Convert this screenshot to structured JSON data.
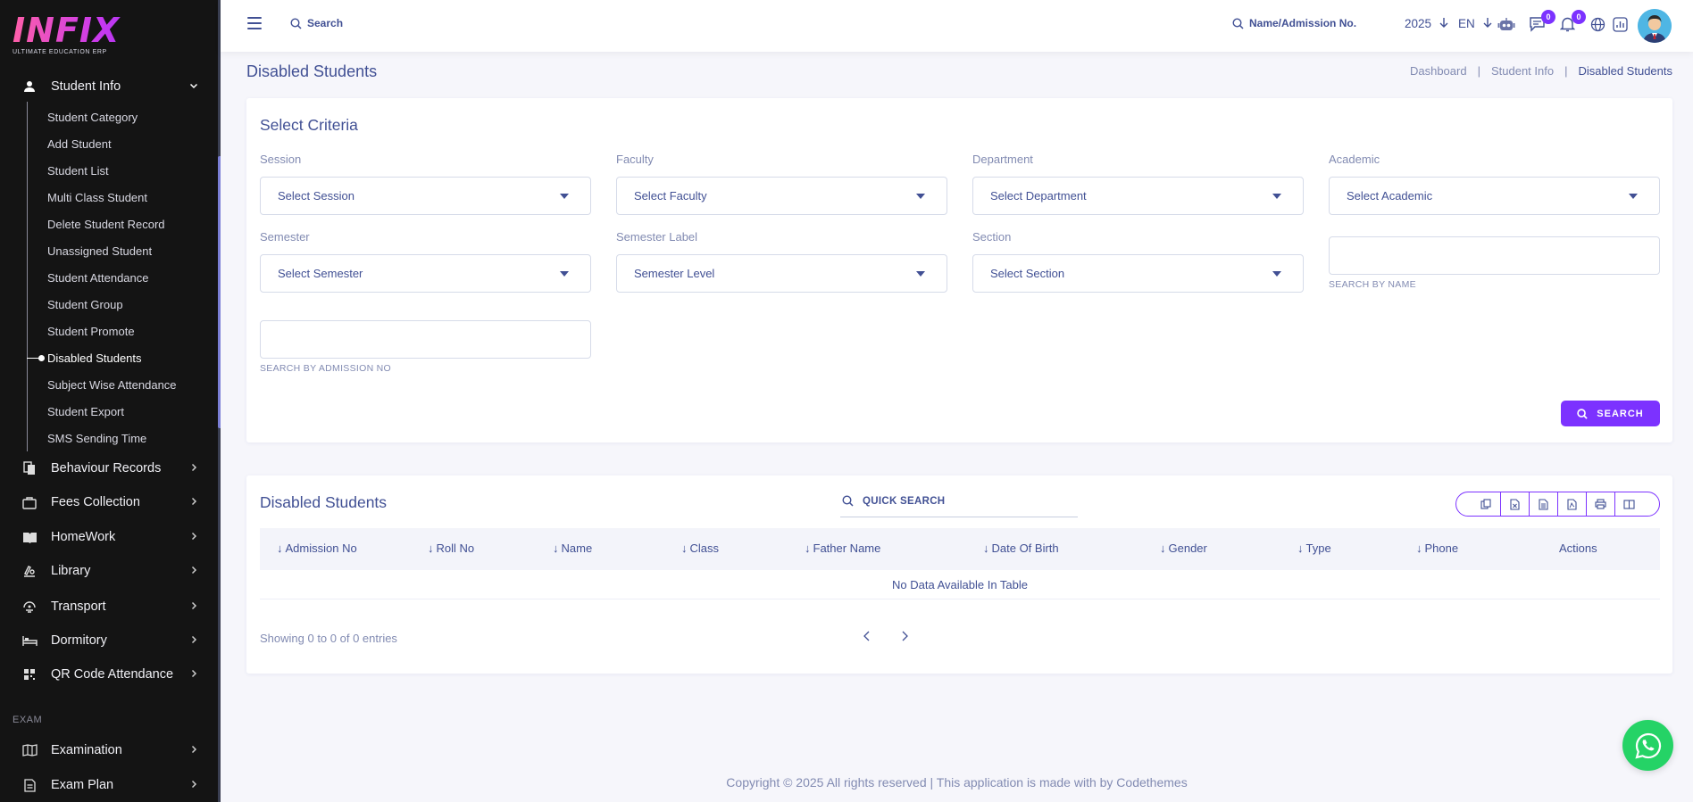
{
  "logo": {
    "word": "INFIX",
    "tagline": "ULTIMATE EDUCATION ERP"
  },
  "sidebar": {
    "student_info": "Student Info",
    "sub_items": [
      "Student Category",
      "Add Student",
      "Student List",
      "Multi Class Student",
      "Delete Student Record",
      "Unassigned Student",
      "Student Attendance",
      "Student Group",
      "Student Promote",
      "Disabled Students",
      "Subject Wise Attendance",
      "Student Export",
      "SMS Sending Time"
    ],
    "active_item": "Disabled Students",
    "menus": [
      "Behaviour Records",
      "Fees Collection",
      "HomeWork",
      "Library",
      "Transport",
      "Dormitory",
      "QR Code Attendance"
    ],
    "section_exam": "EXAM",
    "exam_menus": [
      "Examination",
      "Exam Plan"
    ]
  },
  "topbar": {
    "search_label": "Search",
    "admission_search": "Name/Admission No.",
    "year": "2025",
    "lang": "EN",
    "chat_badge": "0",
    "notif_badge": "0"
  },
  "page": {
    "title": "Disabled Students",
    "breadcrumb": [
      "Dashboard",
      "|",
      "Student Info",
      "|",
      "Disabled Students"
    ]
  },
  "criteria": {
    "title": "Select Criteria",
    "fields": [
      {
        "label": "Session",
        "value": "Select Session"
      },
      {
        "label": "Faculty",
        "value": "Select Faculty"
      },
      {
        "label": "Department",
        "value": "Select Department"
      },
      {
        "label": "Academic",
        "value": "Select Academic"
      },
      {
        "label": "Semester",
        "value": "Select Semester"
      },
      {
        "label": "Semester Label",
        "value": "Semester Level"
      },
      {
        "label": "Section",
        "value": "Select Section"
      }
    ],
    "search_by_name_hint": "SEARCH BY NAME",
    "search_by_admission_hint": "SEARCH BY ADMISSION NO",
    "search_button": "SEARCH"
  },
  "table": {
    "title": "Disabled Students",
    "quick_search": "QUICK SEARCH",
    "columns": [
      "Admission No",
      "Roll No",
      "Name",
      "Class",
      "Father Name",
      "Date Of Birth",
      "Gender",
      "Type",
      "Phone",
      "Actions"
    ],
    "empty": "No Data Available In Table",
    "showing": "Showing 0 to 0 of 0 entries",
    "prev": "‹",
    "next": "›"
  },
  "footer": "Copyright © 2025 All rights reserved | This application is made with by Codethemes",
  "colors": {
    "accent": "#7c32ff",
    "text": "#415094",
    "muted": "#828bb2",
    "sidebar_bg": "#141414",
    "whatsapp": "#25d366"
  }
}
